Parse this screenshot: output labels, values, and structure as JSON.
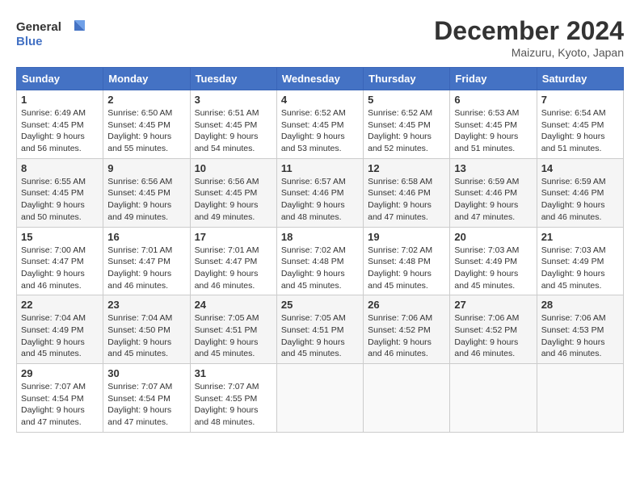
{
  "header": {
    "logo_line1": "General",
    "logo_line2": "Blue",
    "month_title": "December 2024",
    "location": "Maizuru, Kyoto, Japan"
  },
  "weekdays": [
    "Sunday",
    "Monday",
    "Tuesday",
    "Wednesday",
    "Thursday",
    "Friday",
    "Saturday"
  ],
  "weeks": [
    [
      {
        "day": "1",
        "info": "Sunrise: 6:49 AM\nSunset: 4:45 PM\nDaylight: 9 hours\nand 56 minutes."
      },
      {
        "day": "2",
        "info": "Sunrise: 6:50 AM\nSunset: 4:45 PM\nDaylight: 9 hours\nand 55 minutes."
      },
      {
        "day": "3",
        "info": "Sunrise: 6:51 AM\nSunset: 4:45 PM\nDaylight: 9 hours\nand 54 minutes."
      },
      {
        "day": "4",
        "info": "Sunrise: 6:52 AM\nSunset: 4:45 PM\nDaylight: 9 hours\nand 53 minutes."
      },
      {
        "day": "5",
        "info": "Sunrise: 6:52 AM\nSunset: 4:45 PM\nDaylight: 9 hours\nand 52 minutes."
      },
      {
        "day": "6",
        "info": "Sunrise: 6:53 AM\nSunset: 4:45 PM\nDaylight: 9 hours\nand 51 minutes."
      },
      {
        "day": "7",
        "info": "Sunrise: 6:54 AM\nSunset: 4:45 PM\nDaylight: 9 hours\nand 51 minutes."
      }
    ],
    [
      {
        "day": "8",
        "info": "Sunrise: 6:55 AM\nSunset: 4:45 PM\nDaylight: 9 hours\nand 50 minutes."
      },
      {
        "day": "9",
        "info": "Sunrise: 6:56 AM\nSunset: 4:45 PM\nDaylight: 9 hours\nand 49 minutes."
      },
      {
        "day": "10",
        "info": "Sunrise: 6:56 AM\nSunset: 4:45 PM\nDaylight: 9 hours\nand 49 minutes."
      },
      {
        "day": "11",
        "info": "Sunrise: 6:57 AM\nSunset: 4:46 PM\nDaylight: 9 hours\nand 48 minutes."
      },
      {
        "day": "12",
        "info": "Sunrise: 6:58 AM\nSunset: 4:46 PM\nDaylight: 9 hours\nand 47 minutes."
      },
      {
        "day": "13",
        "info": "Sunrise: 6:59 AM\nSunset: 4:46 PM\nDaylight: 9 hours\nand 47 minutes."
      },
      {
        "day": "14",
        "info": "Sunrise: 6:59 AM\nSunset: 4:46 PM\nDaylight: 9 hours\nand 46 minutes."
      }
    ],
    [
      {
        "day": "15",
        "info": "Sunrise: 7:00 AM\nSunset: 4:47 PM\nDaylight: 9 hours\nand 46 minutes."
      },
      {
        "day": "16",
        "info": "Sunrise: 7:01 AM\nSunset: 4:47 PM\nDaylight: 9 hours\nand 46 minutes."
      },
      {
        "day": "17",
        "info": "Sunrise: 7:01 AM\nSunset: 4:47 PM\nDaylight: 9 hours\nand 46 minutes."
      },
      {
        "day": "18",
        "info": "Sunrise: 7:02 AM\nSunset: 4:48 PM\nDaylight: 9 hours\nand 45 minutes."
      },
      {
        "day": "19",
        "info": "Sunrise: 7:02 AM\nSunset: 4:48 PM\nDaylight: 9 hours\nand 45 minutes."
      },
      {
        "day": "20",
        "info": "Sunrise: 7:03 AM\nSunset: 4:49 PM\nDaylight: 9 hours\nand 45 minutes."
      },
      {
        "day": "21",
        "info": "Sunrise: 7:03 AM\nSunset: 4:49 PM\nDaylight: 9 hours\nand 45 minutes."
      }
    ],
    [
      {
        "day": "22",
        "info": "Sunrise: 7:04 AM\nSunset: 4:49 PM\nDaylight: 9 hours\nand 45 minutes."
      },
      {
        "day": "23",
        "info": "Sunrise: 7:04 AM\nSunset: 4:50 PM\nDaylight: 9 hours\nand 45 minutes."
      },
      {
        "day": "24",
        "info": "Sunrise: 7:05 AM\nSunset: 4:51 PM\nDaylight: 9 hours\nand 45 minutes."
      },
      {
        "day": "25",
        "info": "Sunrise: 7:05 AM\nSunset: 4:51 PM\nDaylight: 9 hours\nand 45 minutes."
      },
      {
        "day": "26",
        "info": "Sunrise: 7:06 AM\nSunset: 4:52 PM\nDaylight: 9 hours\nand 46 minutes."
      },
      {
        "day": "27",
        "info": "Sunrise: 7:06 AM\nSunset: 4:52 PM\nDaylight: 9 hours\nand 46 minutes."
      },
      {
        "day": "28",
        "info": "Sunrise: 7:06 AM\nSunset: 4:53 PM\nDaylight: 9 hours\nand 46 minutes."
      }
    ],
    [
      {
        "day": "29",
        "info": "Sunrise: 7:07 AM\nSunset: 4:54 PM\nDaylight: 9 hours\nand 47 minutes."
      },
      {
        "day": "30",
        "info": "Sunrise: 7:07 AM\nSunset: 4:54 PM\nDaylight: 9 hours\nand 47 minutes."
      },
      {
        "day": "31",
        "info": "Sunrise: 7:07 AM\nSunset: 4:55 PM\nDaylight: 9 hours\nand 48 minutes."
      },
      {
        "day": "",
        "info": ""
      },
      {
        "day": "",
        "info": ""
      },
      {
        "day": "",
        "info": ""
      },
      {
        "day": "",
        "info": ""
      }
    ]
  ]
}
